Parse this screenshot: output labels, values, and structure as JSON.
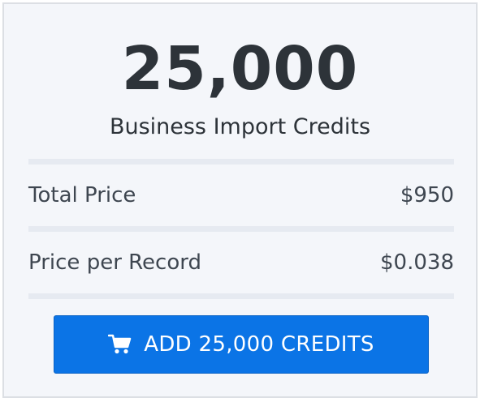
{
  "offer": {
    "amount": "25,000",
    "subtitle": "Business Import Credits"
  },
  "pricing": {
    "rows": [
      {
        "label": "Total Price",
        "value": "$950"
      },
      {
        "label": "Price per Record",
        "value": "$0.038"
      }
    ]
  },
  "cta": {
    "label": "ADD 25,000 CREDITS",
    "icon": "shopping-cart-icon"
  },
  "colors": {
    "background": "#f4f6fa",
    "border": "#dcdfe4",
    "divider": "#e6eaf1",
    "heading_text": "#2d3339",
    "body_text": "#3e4650",
    "button_bg": "#0b74e6",
    "button_text": "#ffffff"
  }
}
